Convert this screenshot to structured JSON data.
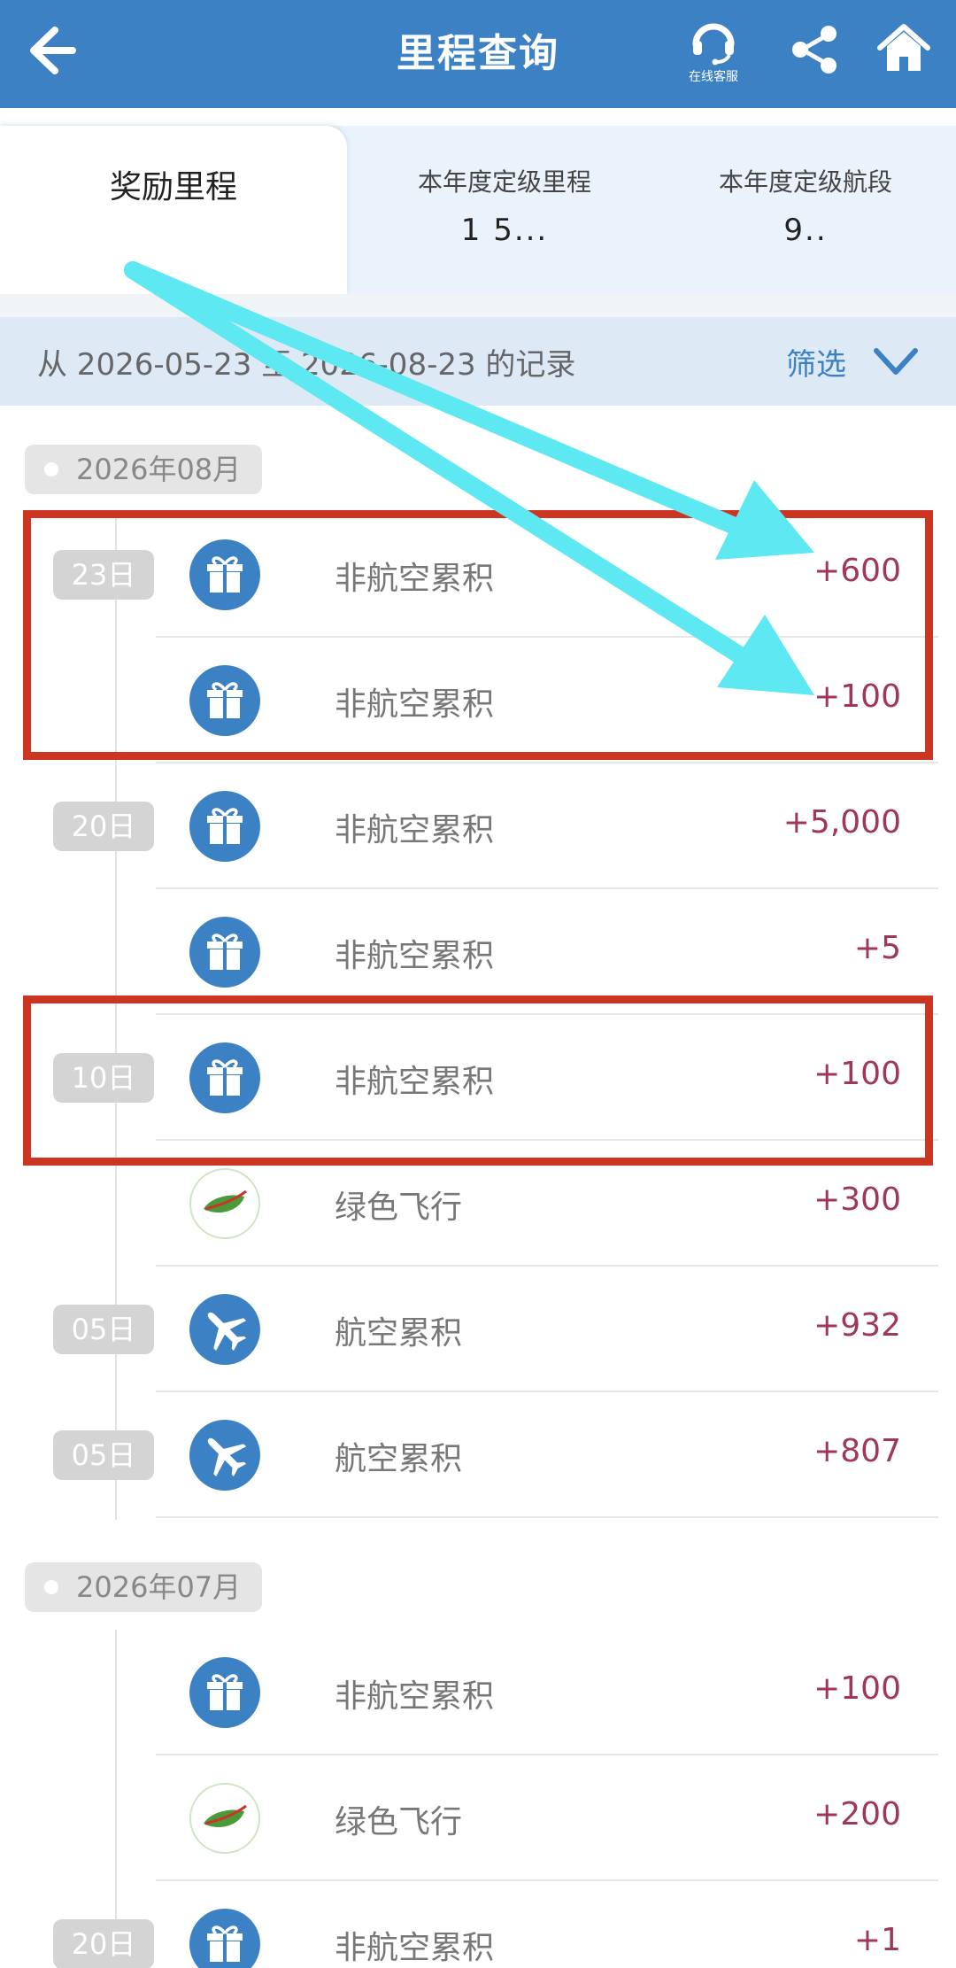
{
  "header": {
    "title": "里程查询",
    "customer_service_label": "在线客服"
  },
  "tabs": [
    {
      "label": "奖励里程",
      "value": ""
    },
    {
      "label": "本年度定级里程",
      "value": "1 5..."
    },
    {
      "label": "本年度定级航段",
      "value": "9.."
    }
  ],
  "filter": {
    "range_text": "从 2026-05-23 至 2026-08-23 的记录",
    "filter_label": "筛选"
  },
  "months": [
    {
      "label": "2026年08月",
      "records": [
        {
          "day": "23日",
          "type": "gift",
          "desc": "非航空累积",
          "amount": "+600"
        },
        {
          "day": "",
          "type": "gift",
          "desc": "非航空累积",
          "amount": "+100"
        },
        {
          "day": "20日",
          "type": "gift",
          "desc": "非航空累积",
          "amount": "+5,000"
        },
        {
          "day": "",
          "type": "gift",
          "desc": "非航空累积",
          "amount": "+5"
        },
        {
          "day": "10日",
          "type": "gift",
          "desc": "非航空累积",
          "amount": "+100"
        },
        {
          "day": "",
          "type": "leaf",
          "desc": "绿色飞行",
          "amount": "+300"
        },
        {
          "day": "05日",
          "type": "plane",
          "desc": "航空累积",
          "amount": "+932"
        },
        {
          "day": "05日",
          "type": "plane",
          "desc": "航空累积",
          "amount": "+807"
        }
      ]
    },
    {
      "label": "2026年07月",
      "records": [
        {
          "day": "",
          "type": "gift",
          "desc": "非航空累积",
          "amount": "+100"
        },
        {
          "day": "",
          "type": "leaf",
          "desc": "绿色飞行",
          "amount": "+200"
        },
        {
          "day": "20日",
          "type": "gift",
          "desc": "非航空累积",
          "amount": "+1"
        }
      ]
    }
  ],
  "colors": {
    "header_bg": "#3b81c4",
    "amount_text": "#a0365a",
    "annotation_box": "#cc3522",
    "annotation_arrow": "#5ee8f2"
  }
}
